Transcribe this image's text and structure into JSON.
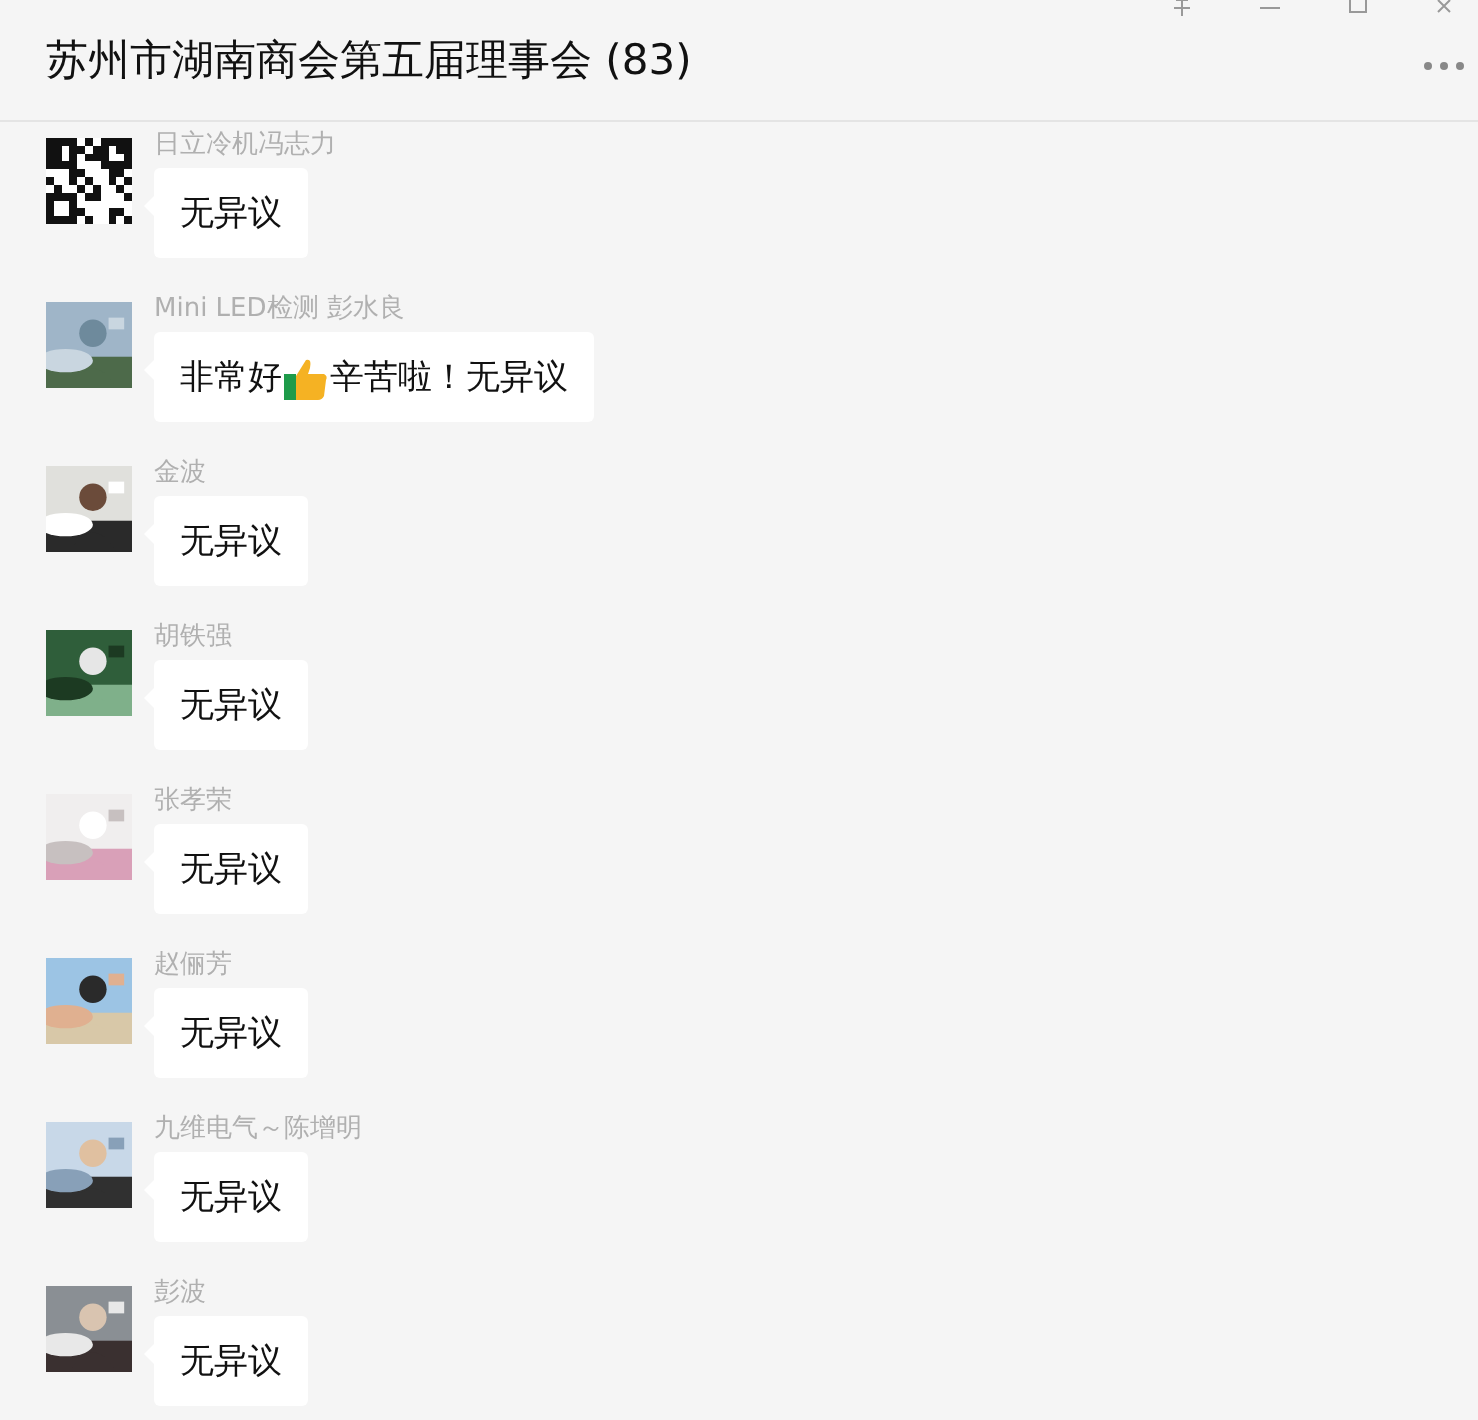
{
  "window": {
    "title": "苏州市湖南商会第五届理事会 (83)"
  },
  "messages": [
    {
      "sender": "日立冷机冯志力",
      "avatar": {
        "kind": "qr"
      },
      "parts": [
        {
          "kind": "text",
          "text": "无异议"
        }
      ]
    },
    {
      "sender": "Mini LED检测 彭水良",
      "parts": [
        {
          "kind": "text",
          "text": "非常好"
        },
        {
          "kind": "emoji"
        },
        {
          "kind": "text",
          "text": "辛苦啦！无异议"
        }
      ]
    },
    {
      "sender": "金波",
      "parts": [
        {
          "kind": "text",
          "text": "无异议"
        }
      ]
    },
    {
      "sender": "胡铁强",
      "parts": [
        {
          "kind": "text",
          "text": "无异议"
        }
      ]
    },
    {
      "sender": "张孝荣",
      "parts": [
        {
          "kind": "text",
          "text": "无异议"
        }
      ]
    },
    {
      "sender": "赵俪芳",
      "parts": [
        {
          "kind": "text",
          "text": "无异议"
        }
      ]
    },
    {
      "sender": "九维电气～陈增明",
      "parts": [
        {
          "kind": "text",
          "text": "无异议"
        }
      ]
    },
    {
      "sender": "彭波",
      "parts": [
        {
          "kind": "text",
          "text": "无异议"
        }
      ]
    }
  ]
}
